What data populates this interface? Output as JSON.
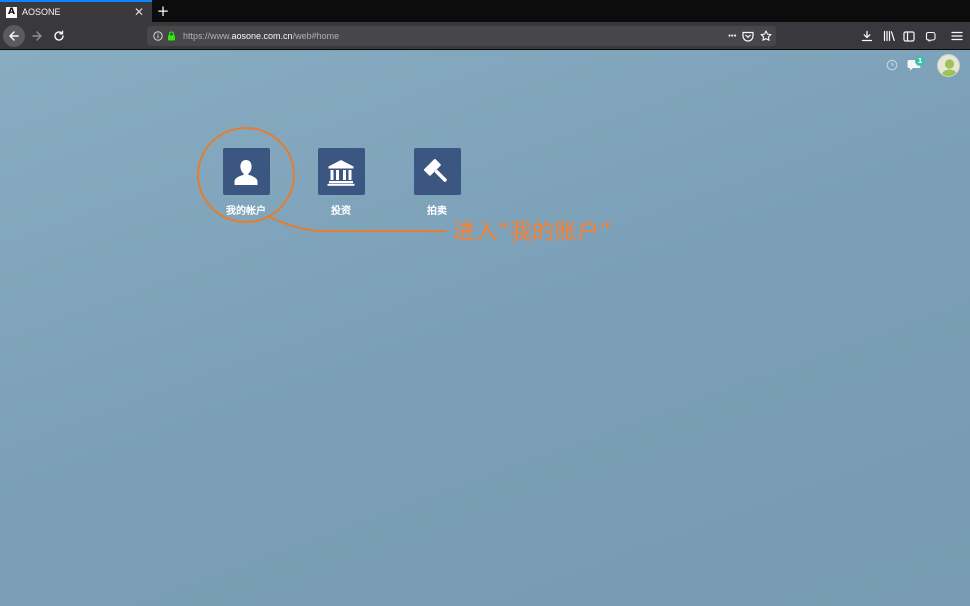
{
  "browser": {
    "tab_title": "AOSONE",
    "tab_favicon_letter": "A",
    "tab_close": "✕",
    "new_tab": "+",
    "url_prefix": "https://www.",
    "url_host": "aosone.com.cn",
    "url_path": "/web#home",
    "url_actions_more": "···"
  },
  "page": {
    "chat_badge_count": "1",
    "apps": [
      {
        "label": "我的帐户",
        "icon": "user-icon"
      },
      {
        "label": "投资",
        "icon": "bank-building-icon"
      },
      {
        "label": "拍卖",
        "icon": "gavel-icon"
      }
    ],
    "annotation": "进入“我的账户”",
    "annotation_color": "#ff7f2a",
    "tile_color": "#3b5680"
  }
}
